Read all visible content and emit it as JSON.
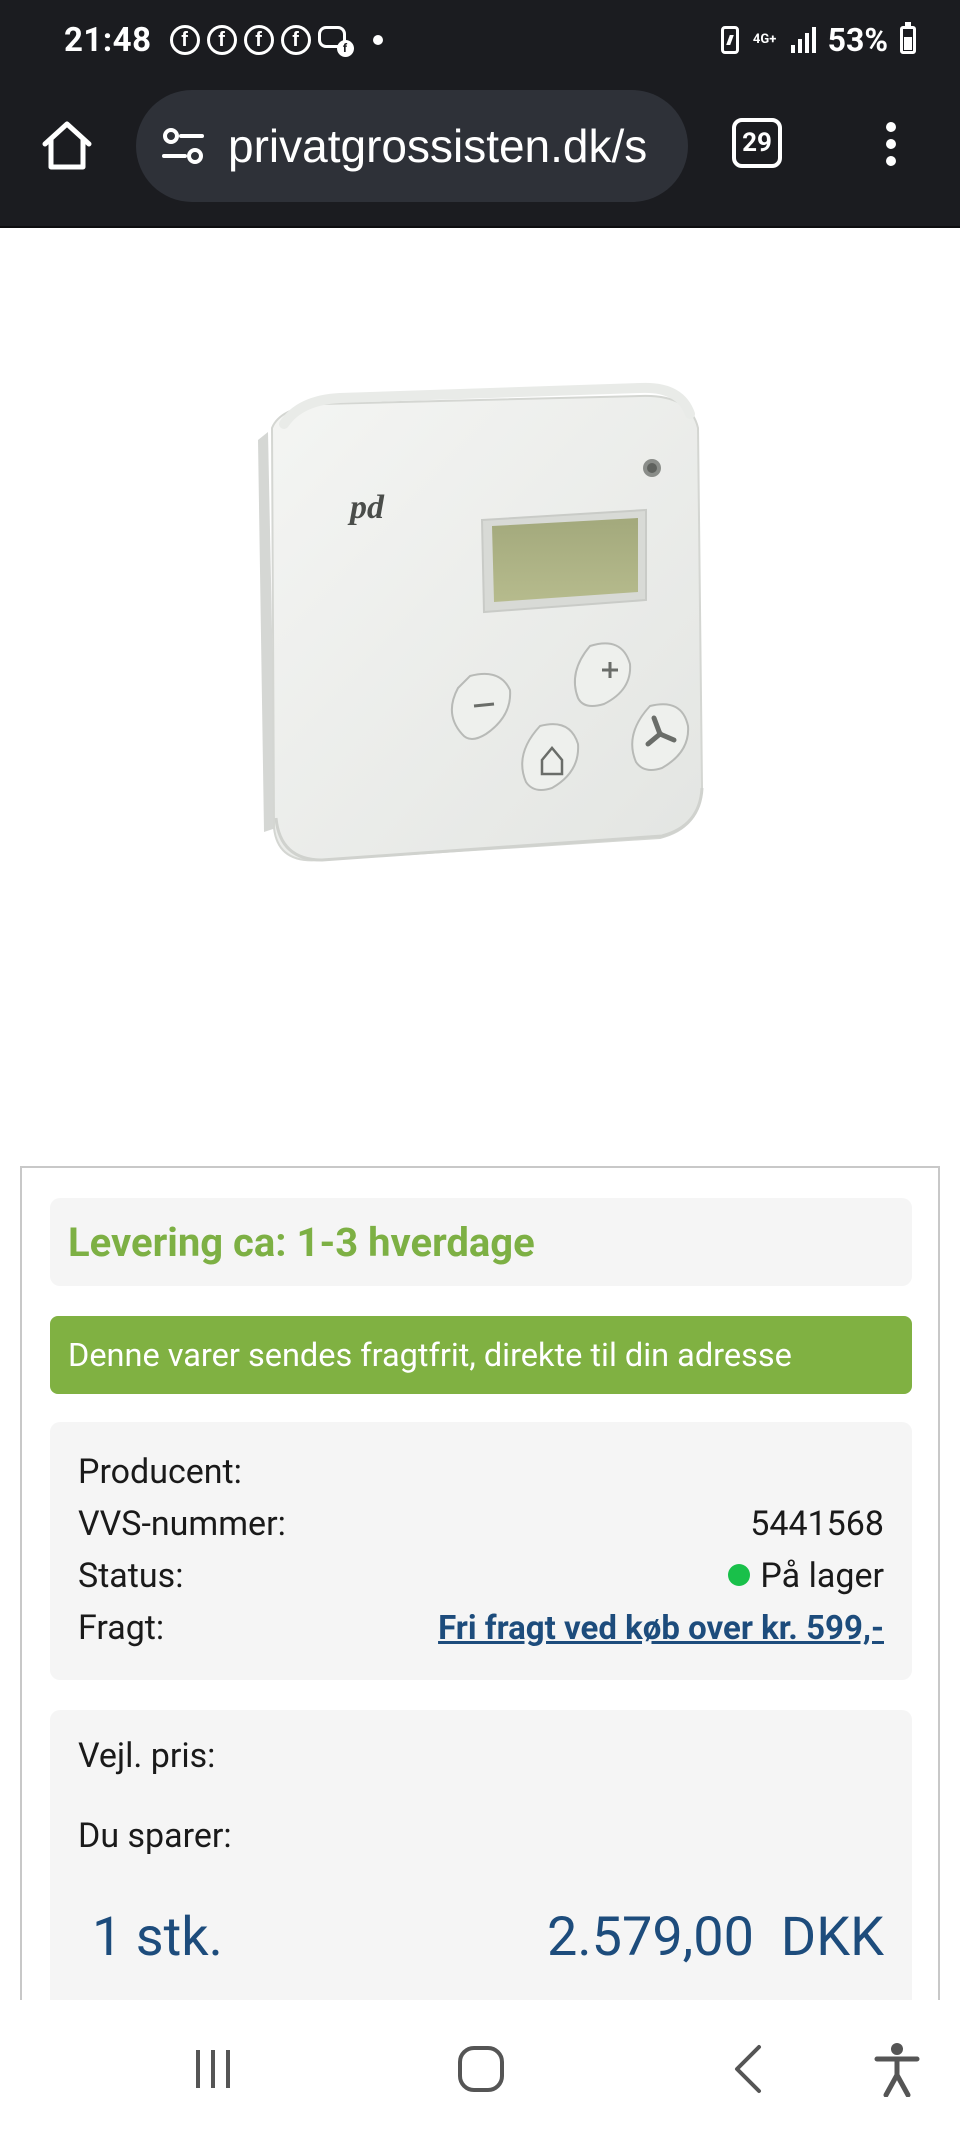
{
  "status_bar": {
    "time": "21:48",
    "notification_icons": [
      "facebook-icon",
      "facebook-icon",
      "facebook-icon",
      "facebook-icon",
      "messenger-icon"
    ],
    "network": "4G+",
    "battery_percent": "53%"
  },
  "browser": {
    "url": "privatgrossisten.dk/s",
    "tab_count": "29"
  },
  "product": {
    "image_brand_mark": "pd"
  },
  "info": {
    "delivery": "Levering ca: 1-3 hverdage",
    "shipping_banner": "Denne varer sendes fragtfrit, direkte til din adresse",
    "details": {
      "producent_label": "Producent:",
      "producent_value": "",
      "vvs_label": "VVS-nummer:",
      "vvs_value": "5441568",
      "status_label": "Status:",
      "status_value": "På lager",
      "fragt_label": "Fragt:",
      "fragt_link": "Fri fragt ved køb over kr. 599,-"
    },
    "price": {
      "vejl_label": "Vejl. pris:",
      "sparer_label": "Du sparer:",
      "quantity": "1 stk.",
      "amount": "2.579,00",
      "currency": "DKK"
    }
  },
  "colors": {
    "accent_green": "#80b142",
    "delivery_green": "#7db044",
    "price_blue": "#1d4c7c",
    "stock_green": "#19c04a",
    "topbar": "#1b1c20"
  }
}
